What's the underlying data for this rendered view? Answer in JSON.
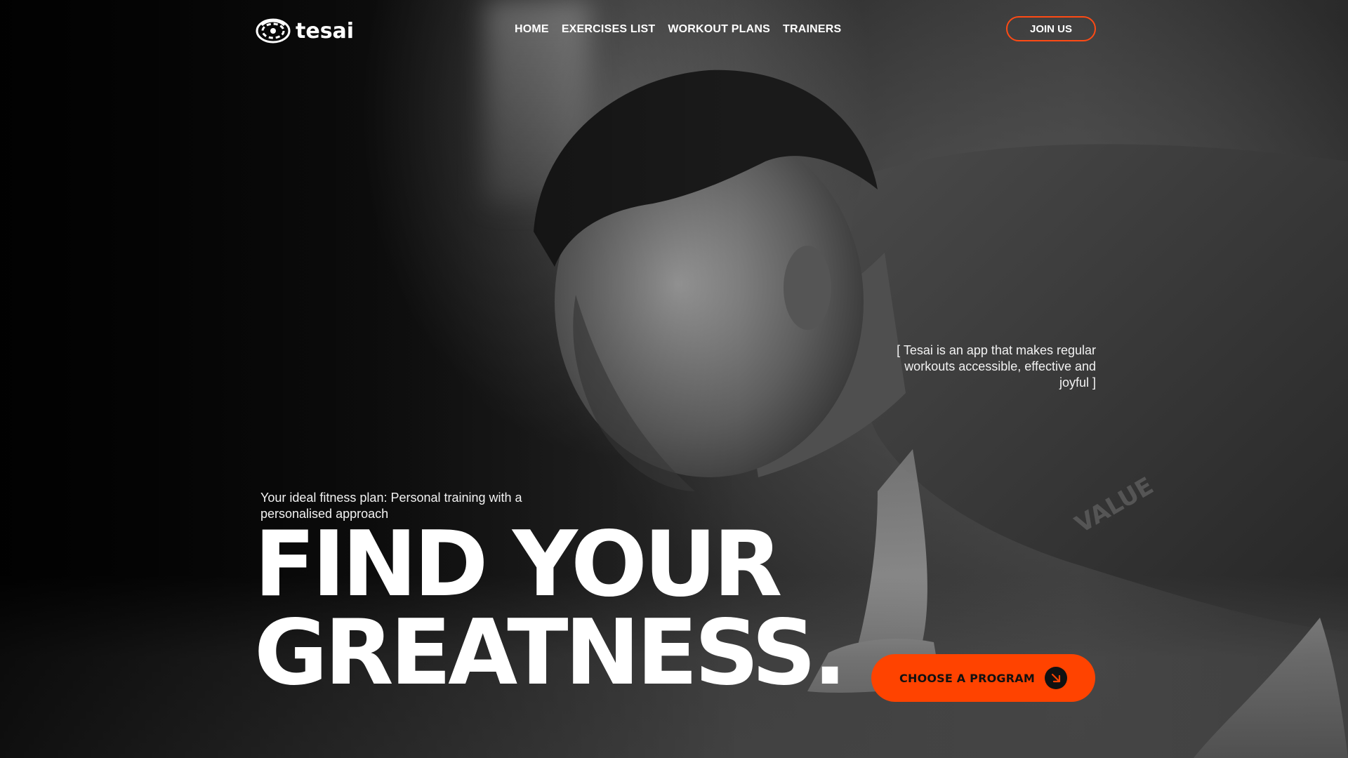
{
  "brand": {
    "name": "tesai",
    "logo_icon": "swirl-logo-icon"
  },
  "nav": {
    "items": [
      {
        "label": "HOME"
      },
      {
        "label": "EXERCISES LIST"
      },
      {
        "label": "WORKOUT PLANS"
      },
      {
        "label": "TRAINERS"
      }
    ],
    "join_label": "JOIN US"
  },
  "hero": {
    "tagline": "[ Tesai is an app that makes regular workouts accessible, effective and joyful ]",
    "subtitle": "Your ideal fitness plan: Personal training with a personalised approach",
    "headline_line1": "FIND YOUR",
    "headline_line2": "GREATNESS.",
    "cta_label": "CHOOSE A PROGRAM",
    "cta_icon": "arrow-down-right-icon",
    "background_image": "athlete-pushup-photo"
  },
  "colors": {
    "accent": "#ff4300",
    "text": "#ffffff",
    "background": "#0d0d0d"
  }
}
